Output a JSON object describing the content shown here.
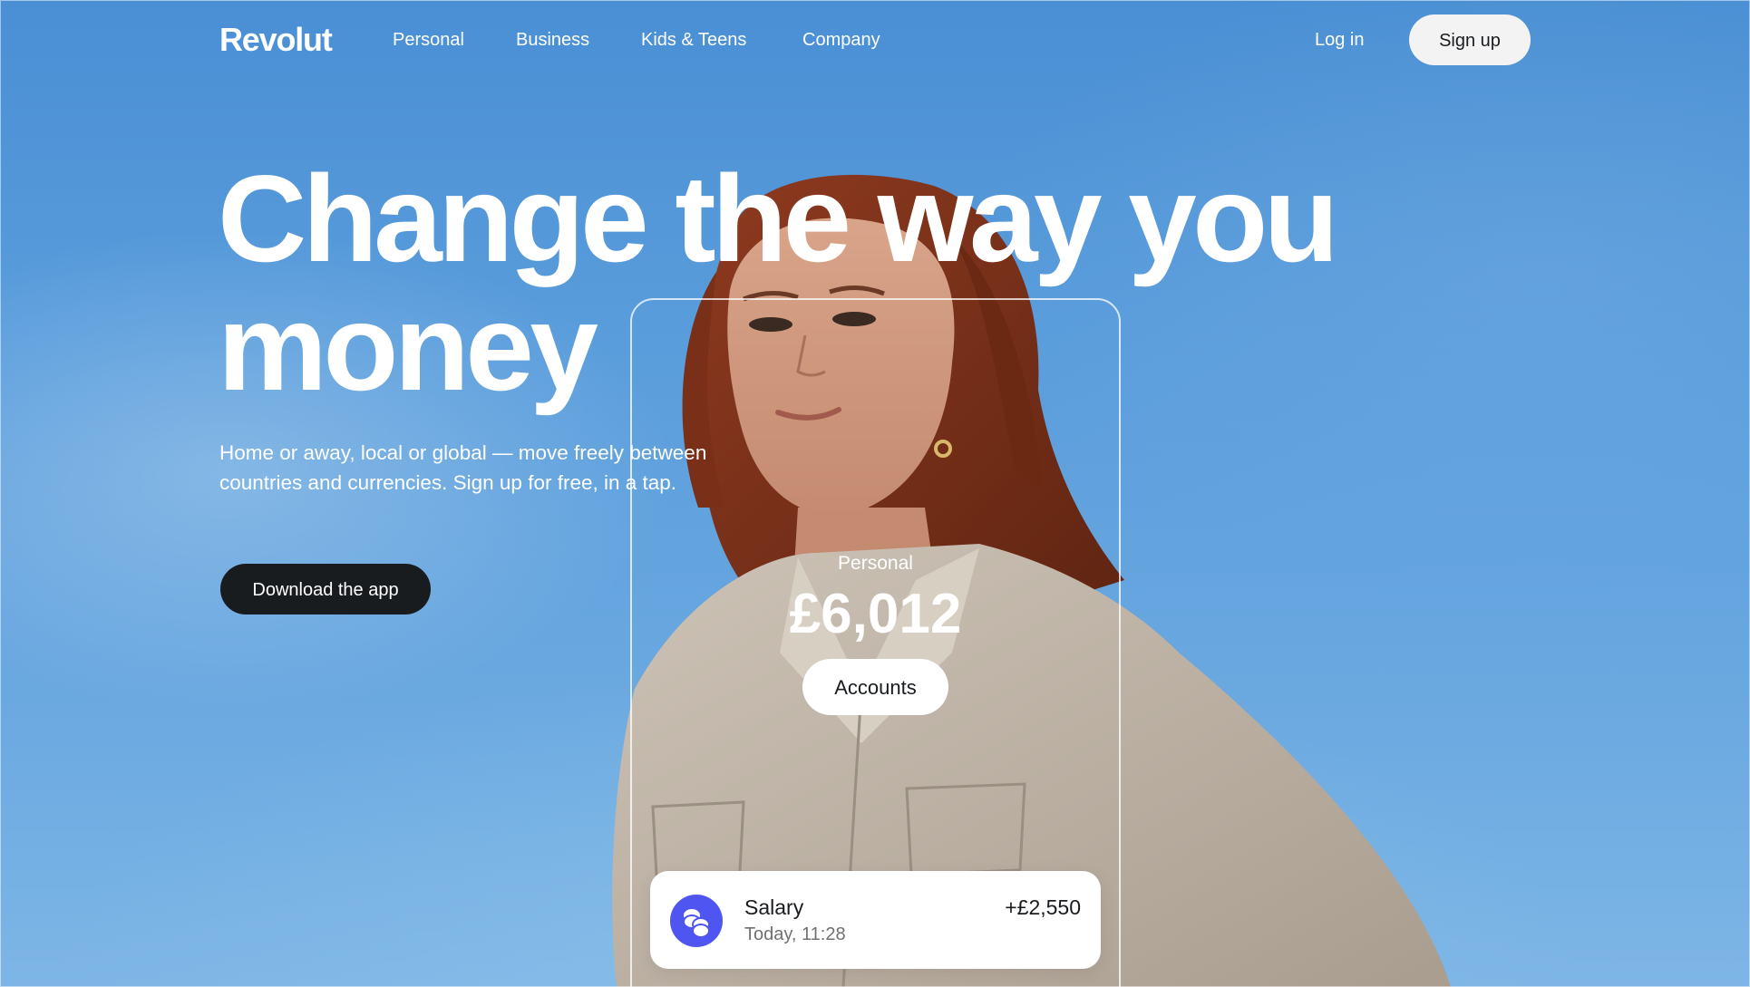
{
  "brand": {
    "logo_text": "Revolut"
  },
  "nav": {
    "items": [
      {
        "label": "Personal"
      },
      {
        "label": "Business"
      },
      {
        "label": "Kids & Teens"
      },
      {
        "label": "Company"
      }
    ],
    "login_label": "Log in",
    "signup_label": "Sign up"
  },
  "hero": {
    "headline_line1": "Change the way you",
    "headline_line2": "money",
    "subtitle": "Home or away, local or global — move freely between countries and currencies. Sign up for free, in a tap.",
    "download_label": "Download the app"
  },
  "account_card": {
    "label": "Personal",
    "balance": "£6,012",
    "button_label": "Accounts"
  },
  "transaction": {
    "icon": "coins-icon",
    "title": "Salary",
    "time": "Today, 11:28",
    "amount": "+£2,550"
  },
  "colors": {
    "sky": "#5a9ddc",
    "dark_button": "#191c1f",
    "light_button": "#f3f3f3",
    "icon_accent": "#4f55f1"
  }
}
